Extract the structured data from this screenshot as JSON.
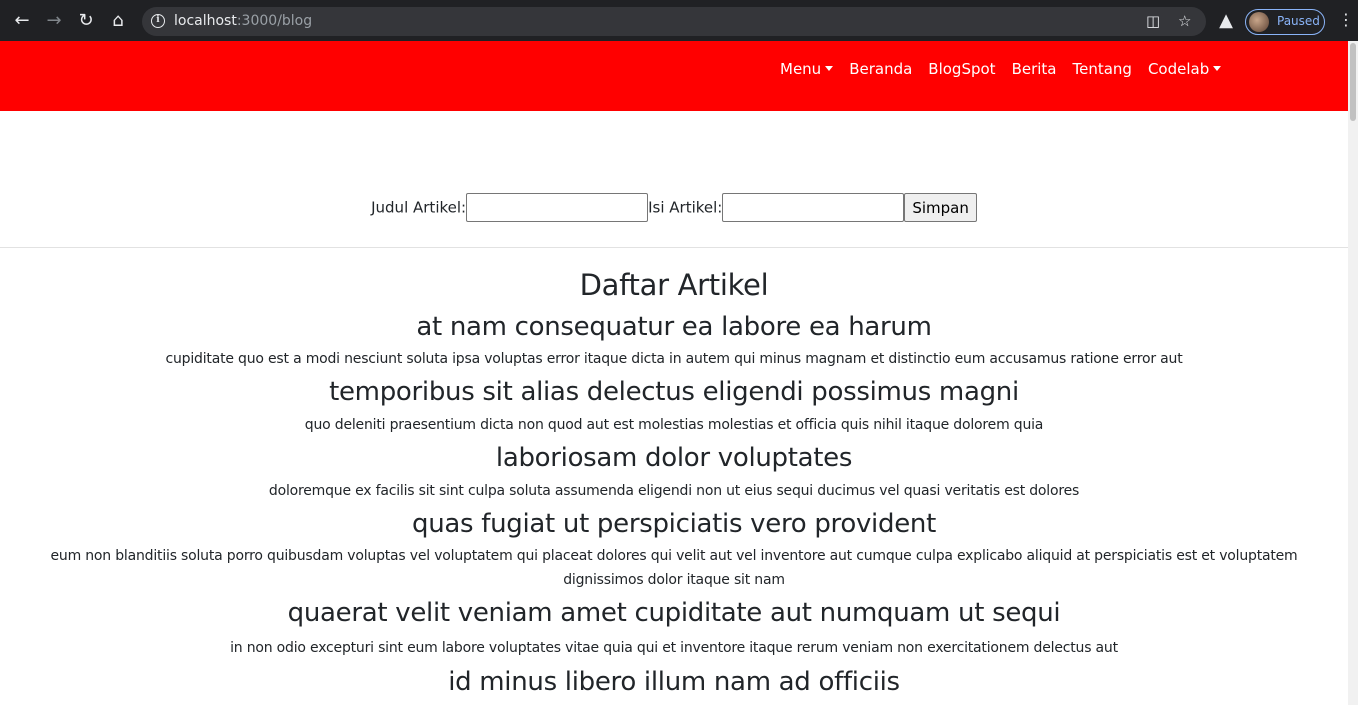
{
  "browser": {
    "url_host": "localhost",
    "url_path": ":3000/blog",
    "profile_status": "Paused"
  },
  "nav": {
    "items": [
      {
        "label": "Menu",
        "dropdown": true
      },
      {
        "label": "Beranda",
        "dropdown": false
      },
      {
        "label": "BlogSpot",
        "dropdown": false
      },
      {
        "label": "Berita",
        "dropdown": false
      },
      {
        "label": "Tentang",
        "dropdown": false
      },
      {
        "label": "Codelab",
        "dropdown": true
      }
    ],
    "background_color": "#ff0000"
  },
  "form": {
    "title_label": "Judul Artikel:",
    "title_value": "",
    "content_label": "Isi Artikel:",
    "content_value": "",
    "submit_label": "Simpan"
  },
  "articles": {
    "heading": "Daftar Artikel",
    "items": [
      {
        "title": "at nam consequatur ea labore ea harum",
        "body": "cupiditate quo est a modi nesciunt soluta ipsa voluptas error itaque dicta in autem qui minus magnam et distinctio eum accusamus ratione error aut"
      },
      {
        "title": "temporibus sit alias delectus eligendi possimus magni",
        "body": "quo deleniti praesentium dicta non quod aut est molestias molestias et officia quis nihil itaque dolorem quia"
      },
      {
        "title": "laboriosam dolor voluptates",
        "body": "doloremque ex facilis sit sint culpa soluta assumenda eligendi non ut eius sequi ducimus vel quasi veritatis est dolores"
      },
      {
        "title": "quas fugiat ut perspiciatis vero provident",
        "body": "eum non blanditiis soluta porro quibusdam voluptas vel voluptatem qui placeat dolores qui velit aut vel inventore aut cumque culpa explicabo aliquid at perspiciatis est et voluptatem dignissimos dolor itaque sit nam"
      },
      {
        "title": "quaerat velit veniam amet cupiditate aut numquam ut sequi",
        "body": "in non odio excepturi sint eum labore voluptates vitae quia qui et inventore itaque rerum veniam non exercitationem delectus aut"
      },
      {
        "title": "id minus libero illum nam ad officiis",
        "body": ""
      }
    ]
  }
}
